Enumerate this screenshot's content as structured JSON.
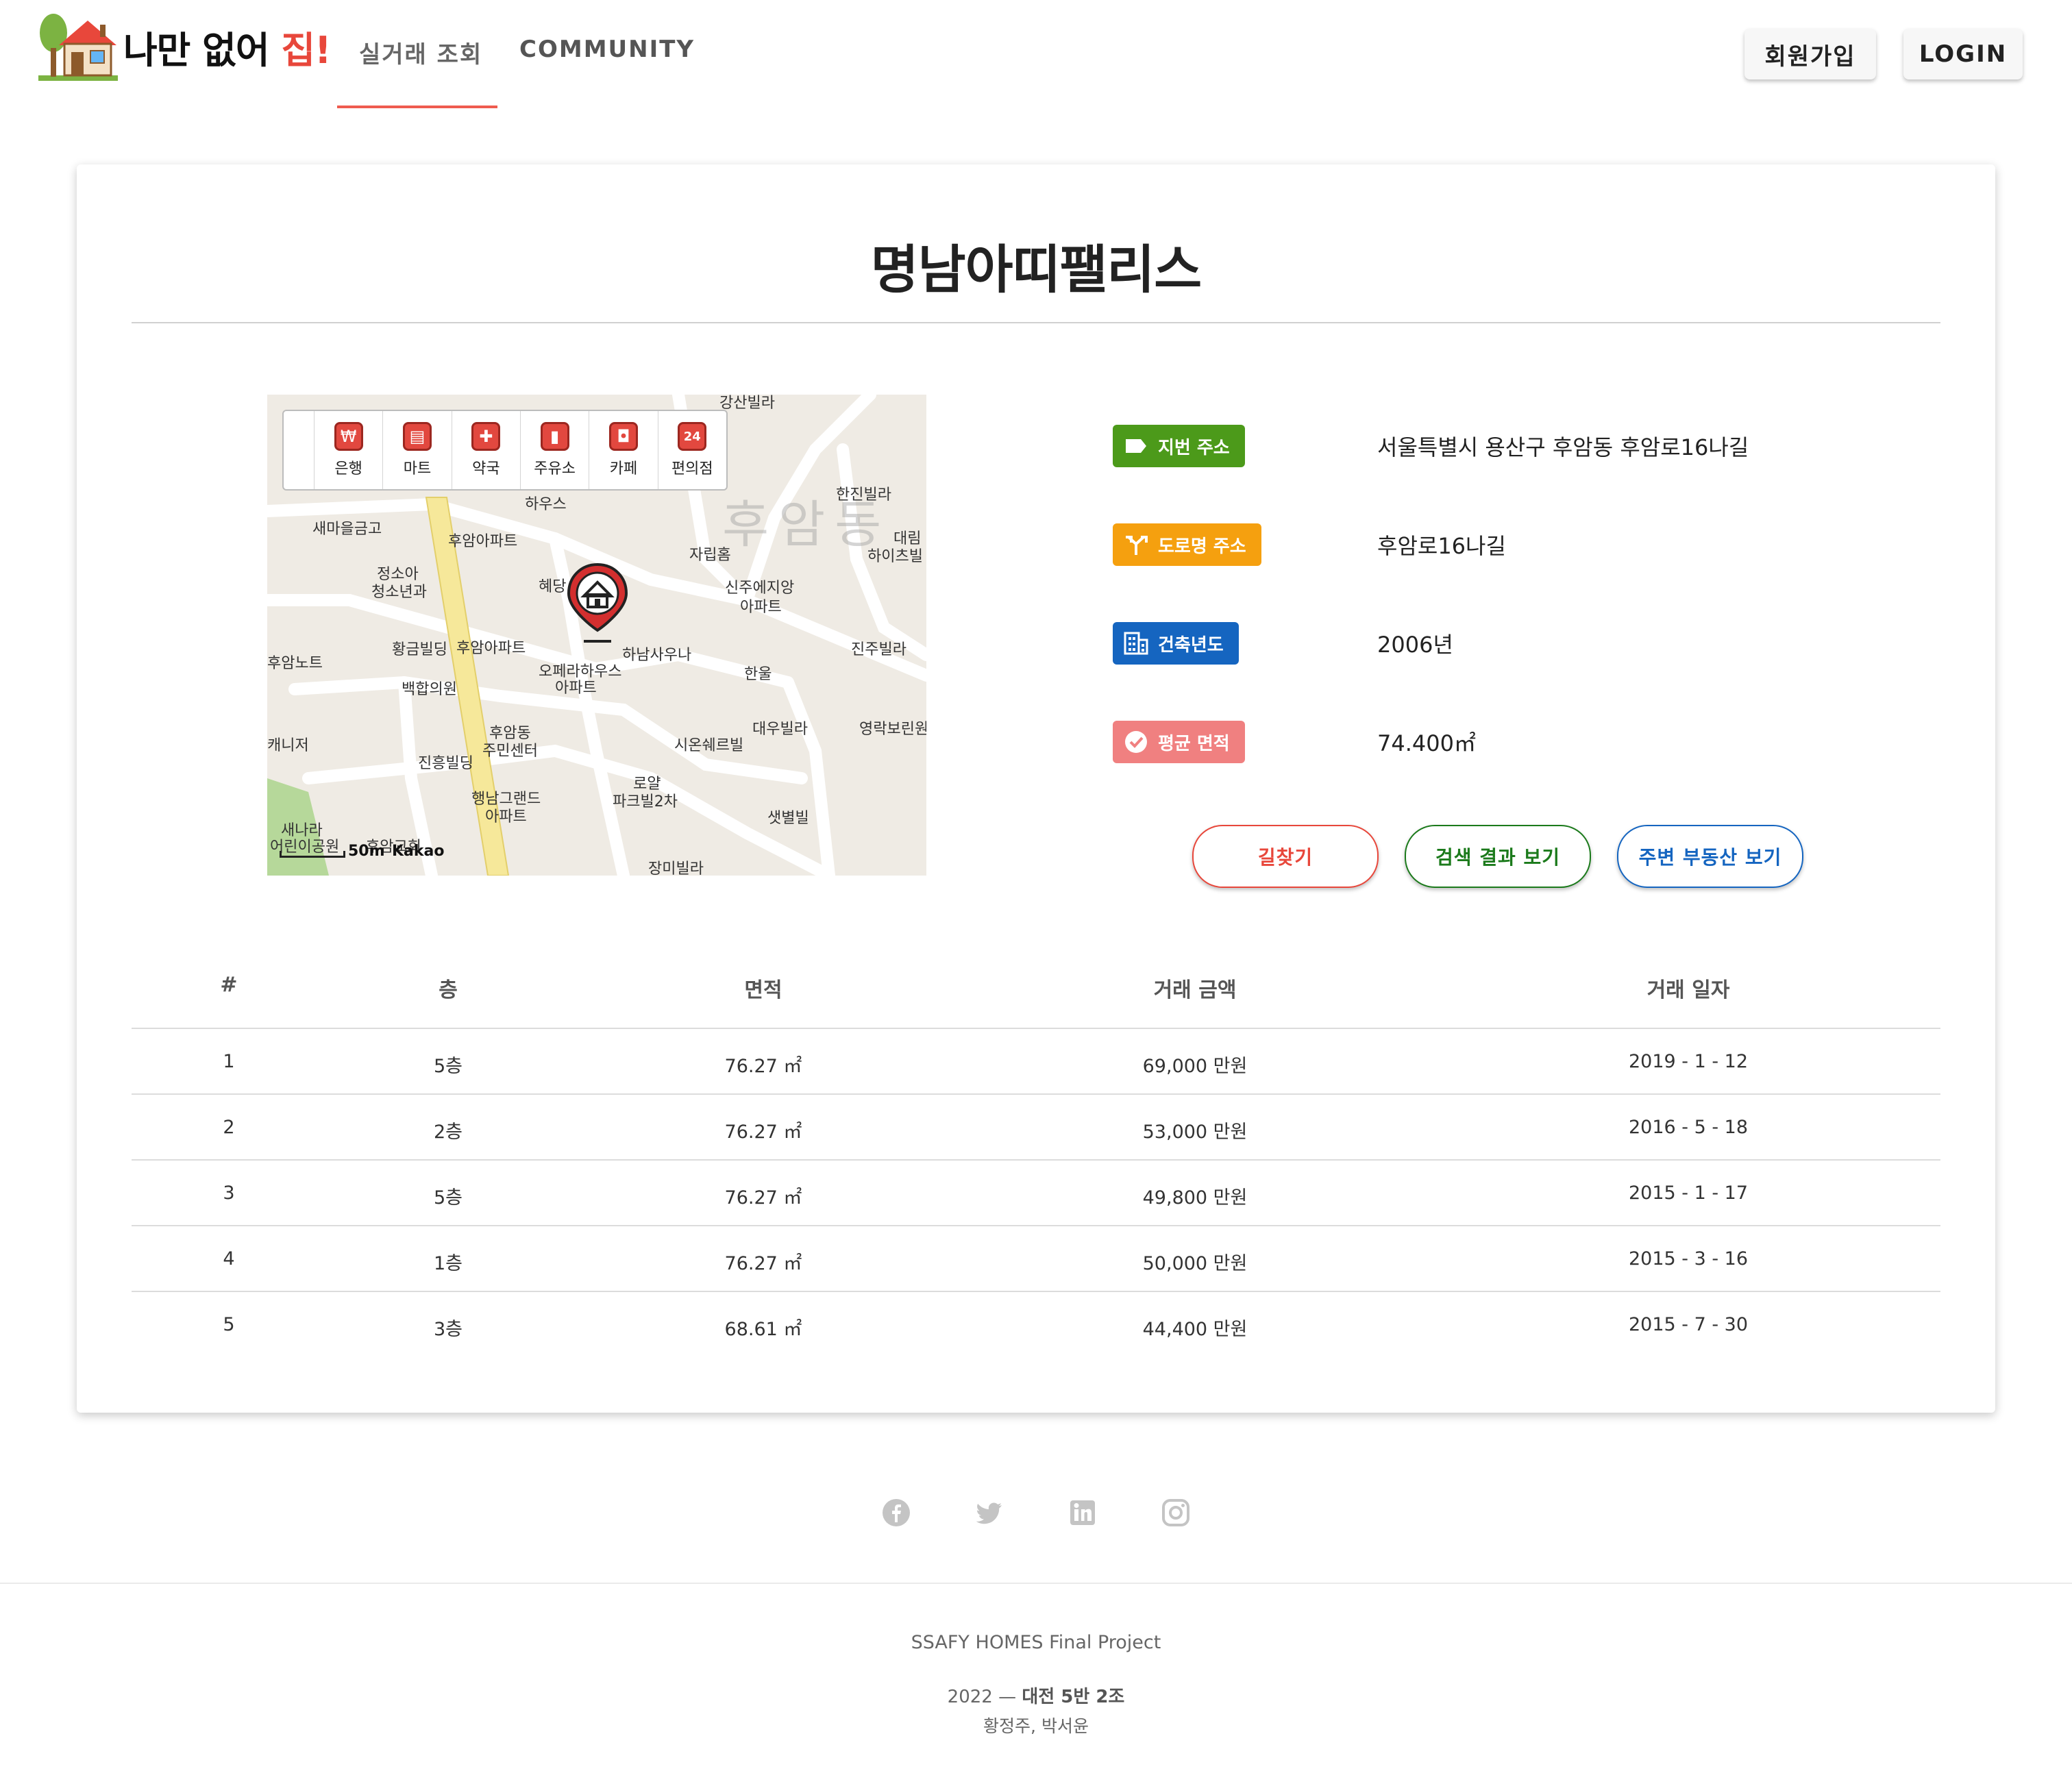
{
  "header": {
    "logo": {
      "text_main": "나만 없어 ",
      "text_accent": "집!"
    },
    "nav": [
      {
        "label": "실거래 조회",
        "active": true
      },
      {
        "label": "COMMUNITY",
        "active": false
      }
    ],
    "signup_label": "회원가입",
    "login_label": "LOGIN"
  },
  "apartment": {
    "name": "명남아띠팰리스"
  },
  "map": {
    "toolbar": [
      {
        "label": "은행",
        "icon": "bank-icon",
        "glyph": "₩"
      },
      {
        "label": "마트",
        "icon": "cart-icon",
        "glyph": "🛒"
      },
      {
        "label": "약국",
        "icon": "pharmacy-icon",
        "glyph": "✚"
      },
      {
        "label": "주유소",
        "icon": "gas-station-icon",
        "glyph": "⛽"
      },
      {
        "label": "카페",
        "icon": "coffee-icon",
        "glyph": "☕"
      },
      {
        "label": "편의점",
        "icon": "convenience-store-icon",
        "glyph": "24"
      }
    ],
    "area_label": "후암동",
    "labels": [
      "새마을금고",
      "하우스",
      "후암아파트",
      "정소아",
      "청소년과",
      "황금빌딩",
      "후암아파트",
      "백합의원",
      "자립홈",
      "한진빌라",
      "대림",
      "하이츠빌",
      "신주에지앙",
      "아파트",
      "혜당",
      "하남사우나",
      "오페라하우스",
      "아파트",
      "한울",
      "진주빌라",
      "후암동",
      "주민센터",
      "진흥빌딩",
      "시온쉐르빌",
      "대우빌라",
      "영락보린원",
      "로얄",
      "파크빌2차",
      "행남그랜드",
      "아파트",
      "샛별빌",
      "새나라",
      "어린이공원",
      "후암교회",
      "장미빌라",
      "후암노트",
      "캐니저",
      "강산빌라"
    ],
    "scale": "50m",
    "provider": "Kakao"
  },
  "info": [
    {
      "label": "지번 주소",
      "value": "서울특별시 용산구 후암동 후암로16나길",
      "color": "#4c9a1a",
      "icon": "tag-icon"
    },
    {
      "label": "도로명 주소",
      "value": "후암로16나길",
      "color": "#f5a00f",
      "icon": "signpost-icon"
    },
    {
      "label": "건축년도",
      "value": "2006년",
      "color": "#1565c0",
      "icon": "building-icon"
    },
    {
      "label": "평균 면적",
      "value": "74.400㎡",
      "color": "#f08080",
      "icon": "check-circle-icon"
    }
  ],
  "actions": [
    {
      "label": "길찾기",
      "color": "#e8473b"
    },
    {
      "label": "검색 결과 보기",
      "color": "#1b7a1b"
    },
    {
      "label": "주변 부동산 보기",
      "color": "#1565c0"
    }
  ],
  "table": {
    "headers": [
      "#",
      "층",
      "면적",
      "거래 금액",
      "거래 일자"
    ],
    "rows": [
      [
        "1",
        "5층",
        "76.27 ㎡",
        "69,000 만원",
        "2019 - 1 - 12"
      ],
      [
        "2",
        "2층",
        "76.27 ㎡",
        "53,000 만원",
        "2016 - 5 - 18"
      ],
      [
        "3",
        "5층",
        "76.27 ㎡",
        "49,800 만원",
        "2015 - 1 - 17"
      ],
      [
        "4",
        "1층",
        "76.27 ㎡",
        "50,000 만원",
        "2015 - 3 - 16"
      ],
      [
        "5",
        "3층",
        "68.61 ㎡",
        "44,400 만원",
        "2015 - 7 - 30"
      ]
    ]
  },
  "footer": {
    "social": [
      "facebook-icon",
      "twitter-icon",
      "linkedin-icon",
      "instagram-icon"
    ],
    "project": "SSAFY HOMES Final Project",
    "year": "2022 —",
    "team": "대전 5반 2조",
    "members": "황정주, 박서윤"
  }
}
